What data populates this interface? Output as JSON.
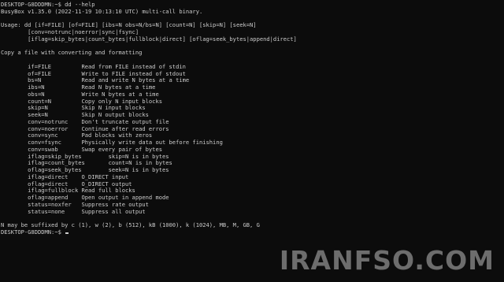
{
  "terminal": {
    "lines": [
      "DESKTOP-G8DDDMN:~$ dd --help",
      "BusyBox v1.35.0 (2022-11-19 10:13:10 UTC) multi-call binary.",
      "",
      "Usage: dd [if=FILE] [of=FILE] [ibs=N obs=N/bs=N] [count=N] [skip=N] [seek=N]",
      "        [conv=notrunc|noerror|sync|fsync]",
      "        [iflag=skip_bytes|count_bytes|fullblock|direct] [oflag=seek_bytes|append|direct]",
      "",
      "Copy a file with converting and formatting",
      "",
      "        if=FILE         Read from FILE instead of stdin",
      "        of=FILE         Write to FILE instead of stdout",
      "        bs=N            Read and write N bytes at a time",
      "        ibs=N           Read N bytes at a time",
      "        obs=N           Write N bytes at a time",
      "        count=N         Copy only N input blocks",
      "        skip=N          Skip N input blocks",
      "        seek=N          Skip N output blocks",
      "        conv=notrunc    Don't truncate output file",
      "        conv=noerror    Continue after read errors",
      "        conv=sync       Pad blocks with zeros",
      "        conv=fsync      Physically write data out before finishing",
      "        conv=swab       Swap every pair of bytes",
      "        iflag=skip_bytes        skip=N is in bytes",
      "        iflag=count_bytes       count=N is in bytes",
      "        oflag=seek_bytes        seek=N is in bytes",
      "        iflag=direct    O_DIRECT input",
      "        oflag=direct    O_DIRECT output",
      "        iflag=fullblock Read full blocks",
      "        oflag=append    Open output in append mode",
      "        status=noxfer   Suppress rate output",
      "        status=none     Suppress all output",
      "",
      "N may be suffixed by c (1), w (2), b (512), kB (1000), k (1024), MB, M, GB, G"
    ],
    "prompt": "DESKTOP-G8DDDMN:~$ "
  },
  "watermark": "IRANFSO.COM"
}
